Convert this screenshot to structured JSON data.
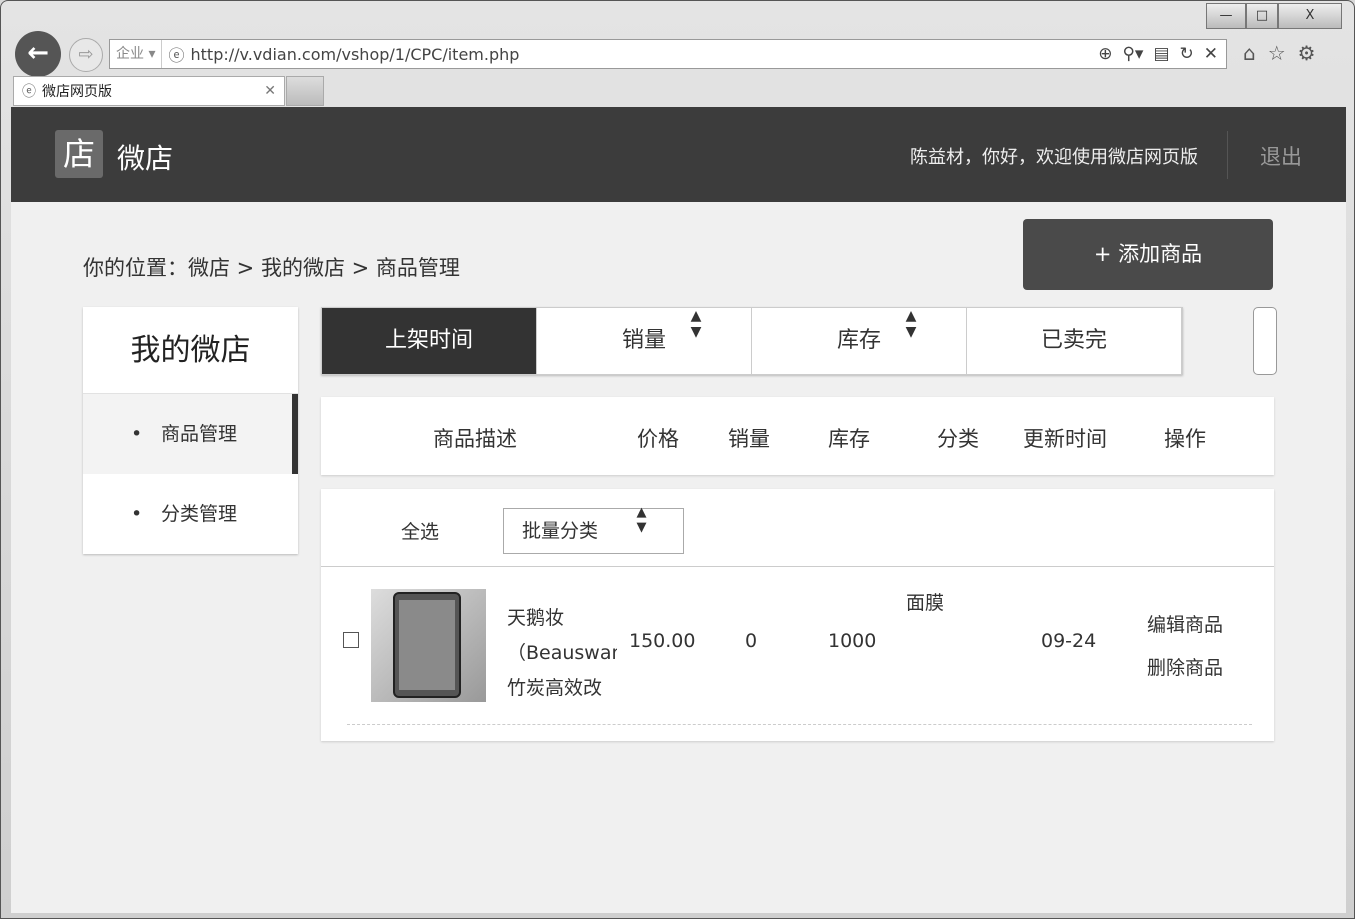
{
  "browser": {
    "zone": "企业",
    "url": "http://v.vdian.com/vshop/1/CPC/item.php",
    "tab_title": "微店网页版",
    "controls": [
      "—",
      "□",
      "X"
    ]
  },
  "header": {
    "logo_char": "店",
    "brand": "微店",
    "welcome": "陈益材，你好，欢迎使用微店网页版",
    "logout": "退出"
  },
  "breadcrumb": "你的位置：微店 > 我的微店 > 商品管理",
  "add_button": "+ 添加商品",
  "sidebar": {
    "title": "我的微店",
    "items": [
      {
        "label": "商品管理",
        "active": true
      },
      {
        "label": "分类管理",
        "active": false
      }
    ]
  },
  "sort_tabs": [
    {
      "label": "上架时间",
      "active": true
    },
    {
      "label": "销量",
      "arrow": "▲▼"
    },
    {
      "label": "库存",
      "arrow": "▲▼"
    },
    {
      "label": "已卖完"
    }
  ],
  "table": {
    "headers": [
      "商品描述",
      "价格",
      "销量",
      "库存",
      "分类",
      "更新时间",
      "操作"
    ],
    "select_all": "全选",
    "batch_select": "批量分类",
    "batch_arrow": "▲▼",
    "rows": [
      {
        "name_lines": [
          "天鹅妆",
          "（Beauswan",
          "竹炭高效改"
        ],
        "price": "150.00",
        "sales": "0",
        "stock": "1000",
        "category": "面膜",
        "updated": "09-24",
        "actions": [
          "编辑商品",
          "删除商品"
        ]
      }
    ]
  }
}
